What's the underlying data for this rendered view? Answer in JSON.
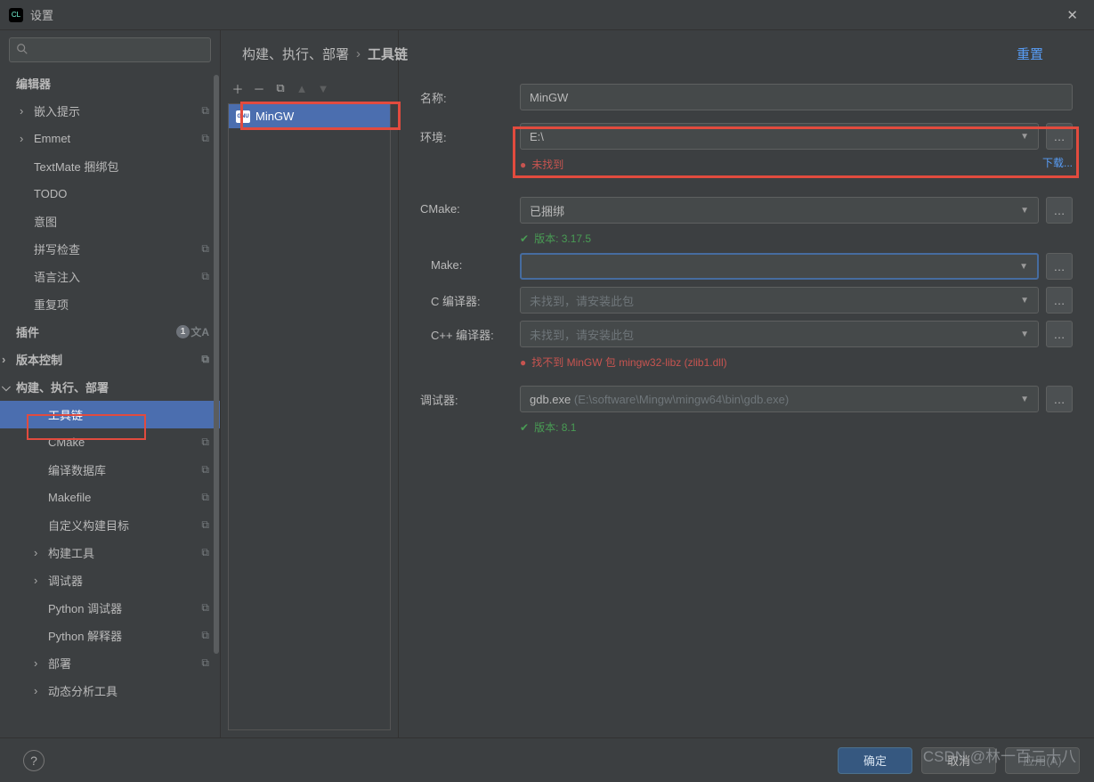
{
  "window": {
    "title": "设置"
  },
  "breadcrumb": {
    "root": "构建、执行、部署",
    "leaf": "工具链",
    "reset": "重置"
  },
  "search": {
    "placeholder": ""
  },
  "sidebar": {
    "editor_label": "编辑器",
    "items": [
      {
        "label": "嵌入提示",
        "indent": 1,
        "chev": true,
        "badge": "stack"
      },
      {
        "label": "Emmet",
        "indent": 1,
        "chev": true,
        "badge": "stack"
      },
      {
        "label": "TextMate 捆绑包",
        "indent": 1
      },
      {
        "label": "TODO",
        "indent": 1
      },
      {
        "label": "意图",
        "indent": 1
      },
      {
        "label": "拼写检查",
        "indent": 1,
        "badge": "stack"
      },
      {
        "label": "语言注入",
        "indent": 1,
        "badge": "stack"
      },
      {
        "label": "重复项",
        "indent": 1
      }
    ],
    "plugins": {
      "label": "插件",
      "count": "1"
    },
    "version_control": {
      "label": "版本控制"
    },
    "build_root": {
      "label": "构建、执行、部署"
    },
    "build_children": [
      {
        "label": "工具链",
        "selected": true
      },
      {
        "label": "CMake",
        "badge": "stack"
      },
      {
        "label": "编译数据库",
        "badge": "stack"
      },
      {
        "label": "Makefile",
        "badge": "stack"
      },
      {
        "label": "自定义构建目标",
        "badge": "stack"
      },
      {
        "label": "构建工具",
        "chev": true,
        "badge": "stack"
      },
      {
        "label": "调试器",
        "chev": true
      },
      {
        "label": "Python 调试器",
        "badge": "stack"
      },
      {
        "label": "Python 解释器",
        "badge": "stack"
      },
      {
        "label": "部署",
        "chev": true,
        "badge": "stack"
      },
      {
        "label": "动态分析工具",
        "chev": true
      }
    ]
  },
  "toolchains": {
    "items": [
      {
        "label": "MinGW",
        "badge": "GNU"
      }
    ]
  },
  "form": {
    "name": {
      "label": "名称:",
      "value": "MinGW"
    },
    "env": {
      "label": "环境:",
      "value": "E:\\",
      "not_found": "未找到",
      "download": "下载..."
    },
    "cmake": {
      "label": "CMake:",
      "value": "已捆绑",
      "version": "版本: 3.17.5"
    },
    "make": {
      "label": "Make:",
      "value": ""
    },
    "cc": {
      "label": "C 编译器:",
      "placeholder": "未找到，请安装此包"
    },
    "cxx": {
      "label": "C++ 编译器:",
      "placeholder": "未找到，请安装此包",
      "err": "找不到 MinGW 包 mingw32-libz (zlib1.dll)"
    },
    "gdb": {
      "label": "调试器:",
      "value": "gdb.exe",
      "path": "(E:\\software\\Mingw\\mingw64\\bin\\gdb.exe)",
      "version": "版本: 8.1"
    }
  },
  "footer": {
    "ok": "确定",
    "cancel": "取消",
    "apply": "应用(A)"
  },
  "watermark": "CSDN @林一百二十八"
}
